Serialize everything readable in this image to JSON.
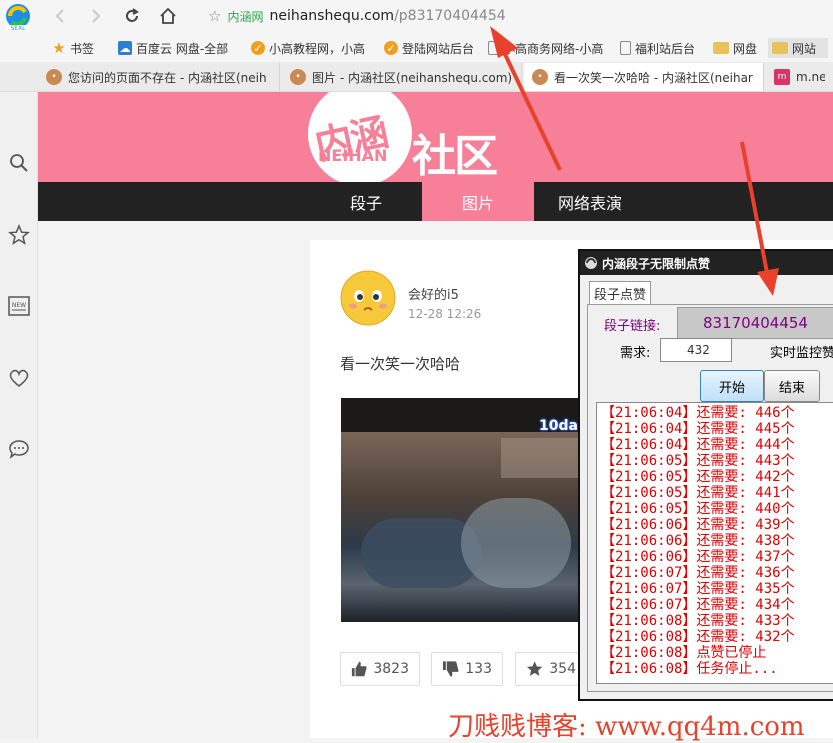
{
  "browser": {
    "address": {
      "site_badge": "内涵网",
      "domain": "neihanshequ.com",
      "path": "/p83170404454"
    },
    "bookmarks": [
      {
        "label": "书签",
        "icon": "star-icon",
        "color": "#f0a020"
      },
      {
        "label": "百度云 网盘-全部",
        "icon": "cloud-icon",
        "color": "#2d7fd3"
      },
      {
        "label": "小高教程网，小高",
        "icon": "shield-icon",
        "color": "#f0a020"
      },
      {
        "label": "登陆网站后台",
        "icon": "shield-icon",
        "color": "#f0a020"
      },
      {
        "label": "小高商务网络-小高",
        "icon": "page-icon",
        "color": "#888888"
      },
      {
        "label": "福利站后台",
        "icon": "page-icon",
        "color": "#888888"
      },
      {
        "label": "网盘",
        "icon": "folder-icon",
        "color": "#e8c25a"
      },
      {
        "label": "网站",
        "icon": "folder-icon",
        "color": "#e8c25a"
      }
    ],
    "tabs": [
      {
        "label": "您访问的页面不存在 - 内涵社区(neih"
      },
      {
        "label": "图片 - 内涵社区(neihanshequ.com)"
      },
      {
        "label": "看一次笑一次哈哈 - 内涵社区(neihar"
      },
      {
        "label": "m.neih"
      }
    ]
  },
  "site": {
    "logo_top": "内涵",
    "logo_sub": "NEIHAN",
    "logo_right": "社区",
    "nav": [
      "段子",
      "图片",
      "网络表演"
    ],
    "active_nav": 1
  },
  "post": {
    "author": "会好的i5",
    "time": "12-28 12:26",
    "text": "看一次笑一次哈哈",
    "video_watermark": "10da",
    "likes": "3823",
    "dislikes": "133",
    "favorites": "354"
  },
  "popup": {
    "title": "内涵段子无限制点赞",
    "tab": "段子点赞",
    "link_label": "段子链接:",
    "link_value": "83170404454",
    "demand_label": "需求:",
    "demand_value": "432",
    "monitor_label": "实时监控赞",
    "start_button": "开始",
    "stop_button": "结束",
    "log": [
      "【21:06:04】还需要: 446个",
      "【21:06:04】还需要: 445个",
      "【21:06:04】还需要: 444个",
      "【21:06:05】还需要: 443个",
      "【21:06:05】还需要: 442个",
      "【21:06:05】还需要: 441个",
      "【21:06:05】还需要: 440个",
      "【21:06:06】还需要: 439个",
      "【21:06:06】还需要: 438个",
      "【21:06:06】还需要: 437个",
      "【21:06:07】还需要: 436个",
      "【21:06:07】还需要: 435个",
      "【21:06:07】还需要: 434个",
      "【21:06:08】还需要: 433个",
      "【21:06:08】还需要: 432个",
      "【21:06:08】点赞已停止",
      "【21:06:08】任务停止..."
    ]
  },
  "watermark": "刀贱贱博客: www.qq4m.com",
  "colors": {
    "banner": "#f77f98",
    "nav_bg": "#222222",
    "log_text": "#e00000",
    "link_value": "#800080",
    "arrow": "#e8412c"
  }
}
